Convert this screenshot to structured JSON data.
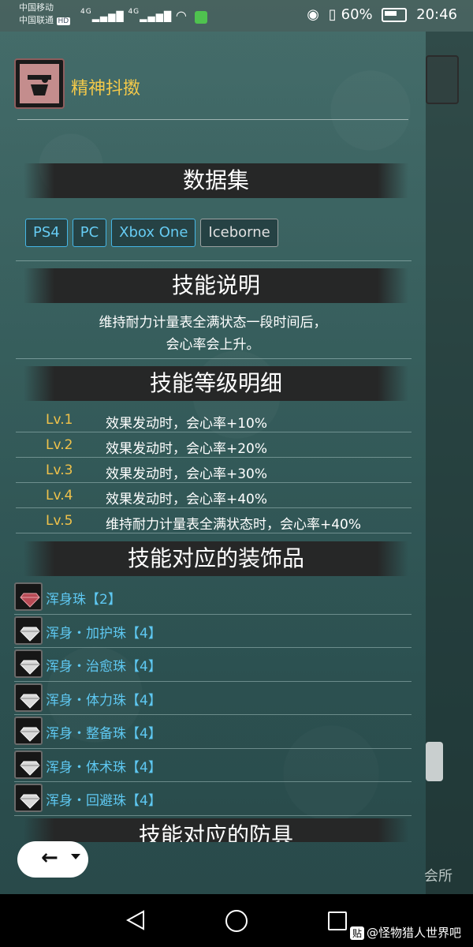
{
  "status_bar": {
    "carrier_1": "中国移动",
    "carrier_2": "中国联通",
    "hd_badge": "HD",
    "signal_1": "4G",
    "signal_2": "4G",
    "battery_percent": "60%",
    "time": "20:46"
  },
  "skill": {
    "name": "精神抖擞"
  },
  "sections": {
    "dataset_title": "数据集",
    "description_title": "技能说明",
    "levels_title": "技能等级明细",
    "decorations_title": "技能对应的装饰品",
    "armor_title_partial": "技能对应的防具"
  },
  "platforms": [
    {
      "label": "PS4"
    },
    {
      "label": "PC"
    },
    {
      "label": "Xbox One"
    },
    {
      "label": "Iceborne"
    }
  ],
  "description": {
    "line1": "维持耐力计量表全满状态一段时间后，",
    "line2": "会心率会上升。"
  },
  "levels": [
    {
      "level": "Lv.1",
      "effect": "效果发动时，会心率+10%"
    },
    {
      "level": "Lv.2",
      "effect": "效果发动时，会心率+20%"
    },
    {
      "level": "Lv.3",
      "effect": "效果发动时，会心率+30%"
    },
    {
      "level": "Lv.4",
      "effect": "效果发动时，会心率+40%"
    },
    {
      "level": "Lv.5",
      "effect": "维持耐力计量表全满状态时，会心率+40%"
    }
  ],
  "decorations": [
    {
      "name": "浑身珠【2】",
      "icon": "red-gem-icon"
    },
    {
      "name": "浑身・加护珠【4】",
      "icon": "white-gem-icon"
    },
    {
      "name": "浑身・治愈珠【4】",
      "icon": "white-gem-icon"
    },
    {
      "name": "浑身・体力珠【4】",
      "icon": "white-gem-icon"
    },
    {
      "name": "浑身・整备珠【4】",
      "icon": "white-gem-icon"
    },
    {
      "name": "浑身・体术珠【4】",
      "icon": "white-gem-icon"
    },
    {
      "name": "浑身・回避珠【4】",
      "icon": "white-gem-icon"
    }
  ],
  "right_edge": {
    "partial_label": "会所"
  },
  "watermark": {
    "badge": "贴",
    "text": "@怪物猎人世界吧"
  },
  "colors": {
    "accent_gold": "#f3c94a",
    "link_blue": "#5ec8f2",
    "tag_border_blue": "#45b6e6"
  }
}
